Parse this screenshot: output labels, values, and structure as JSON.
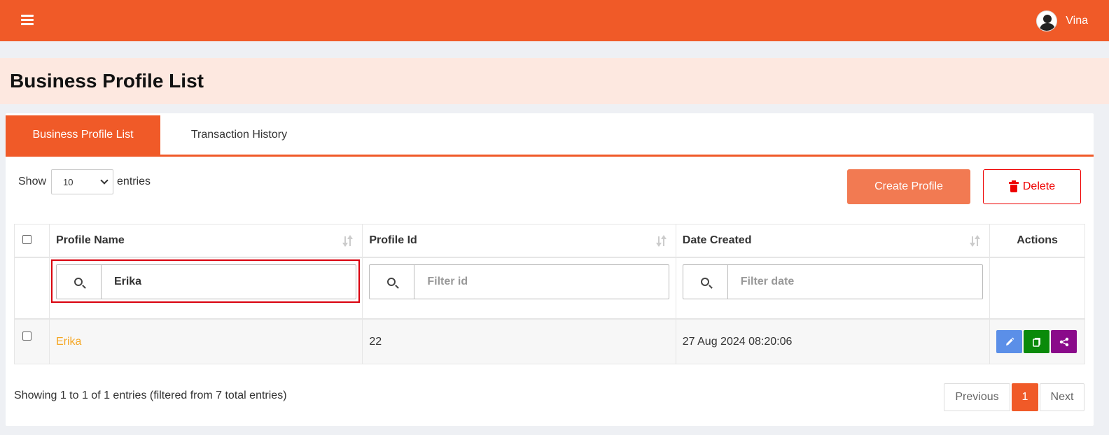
{
  "topbar": {
    "menu_icon": "hamburger-icon",
    "user_name": "Vina",
    "avatar_icon": "user-avatar-icon",
    "color": "#f05a28"
  },
  "page": {
    "title": "Business Profile List"
  },
  "tabs": [
    {
      "label": "Business Profile List",
      "active": true
    },
    {
      "label": "Transaction History",
      "active": false
    }
  ],
  "controls": {
    "show_label": "Show",
    "entries_value": "10",
    "entries_label": "entries",
    "create_label": "Create Profile",
    "delete_label": "Delete",
    "delete_icon": "trash-icon"
  },
  "table": {
    "columns": [
      "Profile Name",
      "Profile Id",
      "Date Created",
      "Actions"
    ],
    "filters": {
      "name_value": "Erika",
      "id_placeholder": "Filter id",
      "date_placeholder": "Filter date"
    },
    "rows": [
      {
        "name": "Erika",
        "id": "22",
        "date": "27 Aug 2024 08:20:06"
      }
    ],
    "action_icons": [
      "edit-icon",
      "copy-icon",
      "share-icon"
    ]
  },
  "footer": {
    "info": "Showing 1 to 1 of 1 entries (filtered from 7 total entries)",
    "prev_label": "Previous",
    "current_page": "1",
    "next_label": "Next"
  }
}
